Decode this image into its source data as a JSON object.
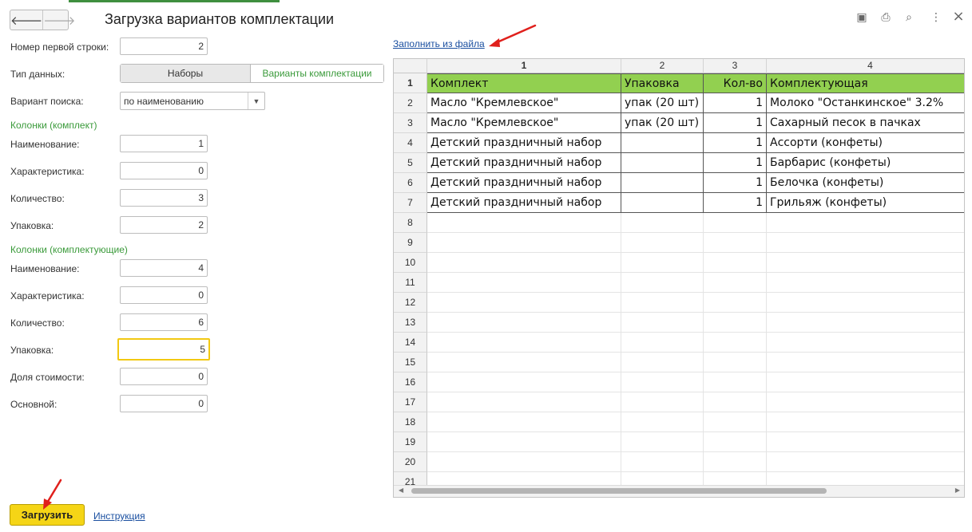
{
  "window": {
    "title": "Загрузка вариантов комплектации",
    "nav_back": "🡐",
    "nav_forward": "🡒",
    "controls": {
      "save": "▣",
      "print": "⎙",
      "preview": "⌕",
      "more": "⋮",
      "close": "×"
    }
  },
  "form": {
    "first_row": {
      "label": "Номер первой строки:",
      "value": "2"
    },
    "data_type": {
      "label": "Тип данных:",
      "options": [
        "Наборы",
        "Варианты комплектации"
      ],
      "selected": "Варианты комплектации"
    },
    "search_variant": {
      "label": "Вариант поиска:",
      "value": "по наименованию",
      "arrow": "▼"
    },
    "section_kit": "Колонки (комплект)",
    "kit": {
      "name": {
        "label": "Наименование:",
        "value": "1"
      },
      "characteristic": {
        "label": "Характеристика:",
        "value": "0"
      },
      "quantity": {
        "label": "Количество:",
        "value": "3"
      },
      "package": {
        "label": "Упаковка:",
        "value": "2"
      }
    },
    "section_components": "Колонки (комплектующие)",
    "components": {
      "name": {
        "label": "Наименование:",
        "value": "4"
      },
      "characteristic": {
        "label": "Характеристика:",
        "value": "0"
      },
      "quantity": {
        "label": "Количество:",
        "value": "6"
      },
      "package": {
        "label": "Упаковка:",
        "value": "5"
      },
      "cost_share": {
        "label": "Доля стоимости:",
        "value": "0"
      },
      "main": {
        "label": "Основной:",
        "value": "0"
      }
    }
  },
  "fill_from_file": "Заполнить из файла",
  "spreadsheet": {
    "columns": [
      "1",
      "2",
      "3",
      "4"
    ],
    "row_numbers": [
      "1",
      "2",
      "3",
      "4",
      "5",
      "6",
      "7",
      "8",
      "9",
      "10",
      "11",
      "12",
      "13",
      "14",
      "15",
      "16",
      "17",
      "18",
      "19",
      "20",
      "21"
    ],
    "rows": [
      [
        "Комплект",
        "Упаковка",
        "Кол-во",
        "Комплектующая"
      ],
      [
        "Масло \"Кремлевское\"",
        "упак (20 шт)",
        "1",
        "Молоко \"Останкинское\" 3.2%"
      ],
      [
        "Масло \"Кремлевское\"",
        "упак (20 шт)",
        "1",
        "Сахарный песок в пачках"
      ],
      [
        "Детский праздничный набор",
        "",
        "1",
        "Ассорти (конфеты)"
      ],
      [
        "Детский праздничный набор",
        "",
        "1",
        "Барбарис (конфеты)"
      ],
      [
        "Детский праздничный набор",
        "",
        "1",
        "Белочка (конфеты)"
      ],
      [
        "Детский праздничный набор",
        "",
        "1",
        "Грильяж (конфеты)"
      ]
    ],
    "header_color": "#92d050",
    "scroll_left": "◀",
    "scroll_right": "▶"
  },
  "buttons": {
    "load": "Загрузить",
    "instruction": "Инструкция"
  },
  "colors": {
    "accent_green": "#3a9a3a",
    "primary_button": "#f5d516",
    "link": "#1a4fa0",
    "annotation_arrow": "#e0201c"
  }
}
